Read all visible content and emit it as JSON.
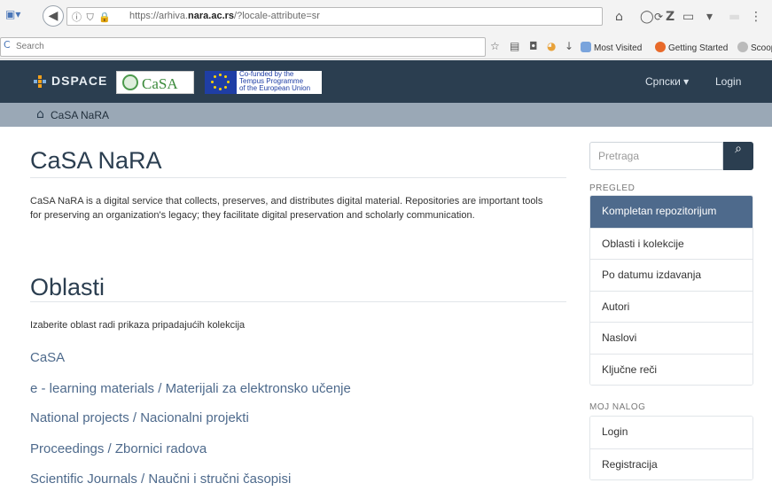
{
  "browser": {
    "url_prefix": "https://arhiva.",
    "url_domain": "nara.ac.rs",
    "url_suffix": "/?locale-attribute=sr",
    "search_placeholder": "Search",
    "bookmarks": [
      "Most Visited",
      "Getting Started",
      "Scoop"
    ]
  },
  "navbar": {
    "brand": "DSPACE",
    "casa_logo": "CaSA",
    "eu_lines": [
      "Co-funded by the",
      "Tempus Programme",
      "of the European Union"
    ],
    "language": "Српски ▾",
    "login": "Login",
    "colors": {
      "bar": "#2b3e50",
      "accent": "#4e6a8c"
    }
  },
  "breadcrumb": {
    "home_label": "CaSA NaRA"
  },
  "main": {
    "title": "CaSA NaRA",
    "intro": "CaSA NaRA is a digital service that collects, preserves, and distributes digital material. Repositories are important tools for preserving an organization's legacy; they facilitate digital preservation and scholarly communication.",
    "section_title": "Oblasti",
    "section_desc": "Izaberite oblast radi prikaza pripadajućih kolekcija",
    "communities": [
      "CaSA",
      "e - learning materials / Materijali za elektronsko učenje",
      "National projects / Nacionalni projekti",
      "Proceedings / Zbornici radova",
      "Scientific Journals / Naučni i stručni časopisi"
    ]
  },
  "sidebar": {
    "search_placeholder": "Pretraga",
    "browse_heading": "PREGLED",
    "browse_items": [
      "Kompletan repozitorijum",
      "Oblasti i kolekcije",
      "Po datumu izdavanja",
      "Autori",
      "Naslovi",
      "Ključne reči"
    ],
    "account_heading": "MOJ NALOG",
    "account_items": [
      "Login",
      "Registracija"
    ]
  }
}
